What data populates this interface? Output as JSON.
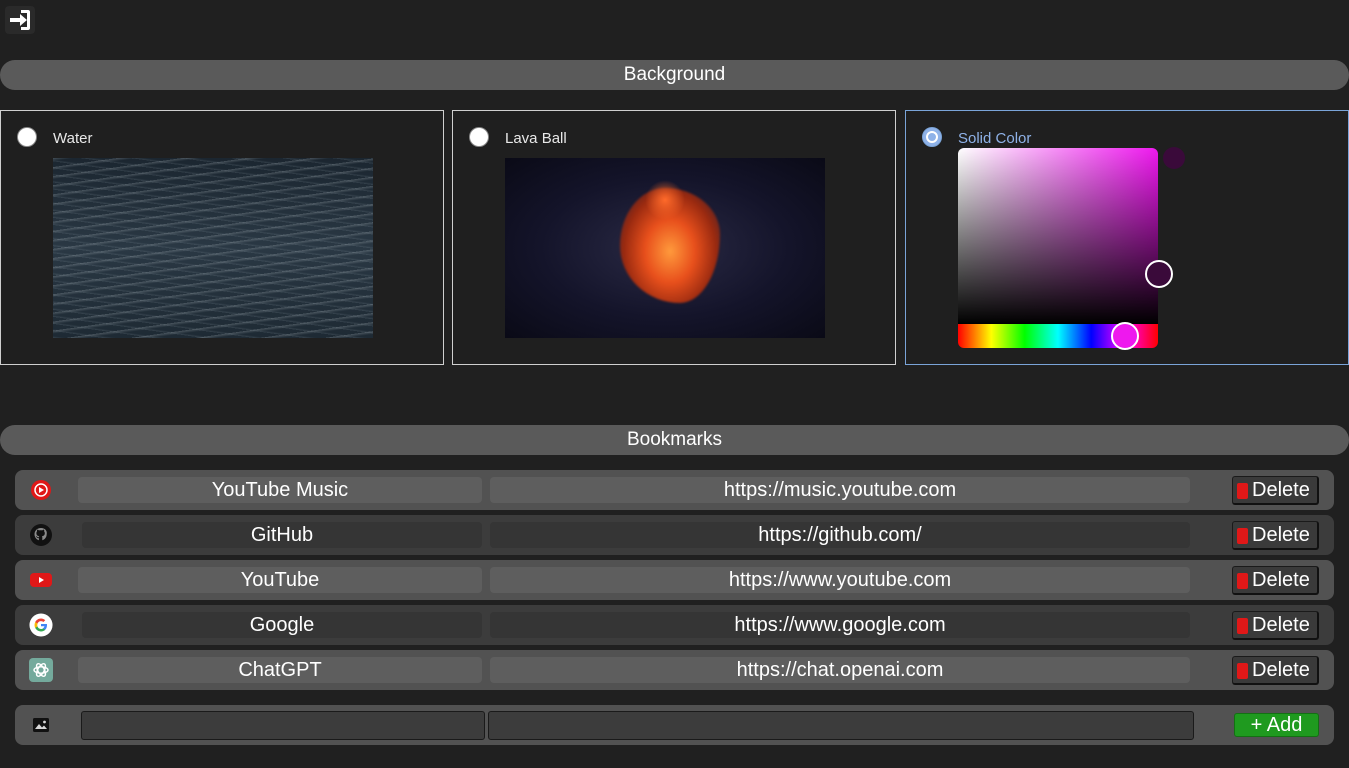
{
  "header": {
    "login_icon": "login-icon"
  },
  "background": {
    "title": "Background",
    "options": [
      {
        "label": "Water",
        "selected": false
      },
      {
        "label": "Lava Ball",
        "selected": false
      },
      {
        "label": "Solid Color",
        "selected": true
      }
    ],
    "color_picker": {
      "hue": "#ee18ee",
      "selected_color": "#3a0a3a"
    }
  },
  "bookmarks": {
    "title": "Bookmarks",
    "items": [
      {
        "name": "YouTube Music",
        "url": "https://music.youtube.com",
        "icon": "youtube-music-icon",
        "delete_label": "Delete"
      },
      {
        "name": "GitHub",
        "url": "https://github.com/",
        "icon": "github-icon",
        "delete_label": "Delete"
      },
      {
        "name": "YouTube",
        "url": "https://www.youtube.com",
        "icon": "youtube-icon",
        "delete_label": "Delete"
      },
      {
        "name": "Google",
        "url": "https://www.google.com",
        "icon": "google-icon",
        "delete_label": "Delete"
      },
      {
        "name": "ChatGPT",
        "url": "https://chat.openai.com",
        "icon": "chatgpt-icon",
        "delete_label": "Delete"
      }
    ],
    "new": {
      "name_value": "",
      "url_value": "",
      "icon": "image-icon",
      "add_label": "+ Add"
    }
  },
  "colors": {
    "add_green": "#1f9a1f",
    "delete_red": "#e01818",
    "selected_blue": "#8fb2e8"
  }
}
